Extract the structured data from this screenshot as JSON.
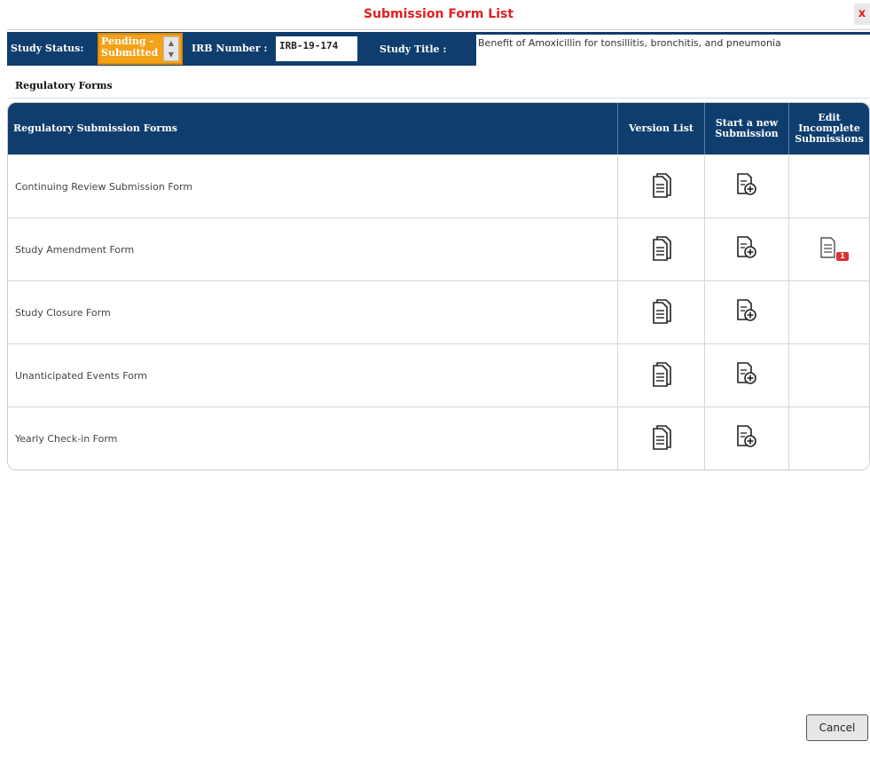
{
  "dialog": {
    "title": "Submission Form List",
    "close_label": "x"
  },
  "study": {
    "status_label": "Study Status:",
    "status_value": "Pending - Submitted",
    "irb_label": "IRB Number :",
    "irb_value": "IRB-19-174",
    "title_label": "Study Title :",
    "title_value": "Benefit of Amoxicillin for tonsillitis, bronchitis, and pneumonia"
  },
  "section": {
    "heading": "Regulatory Forms"
  },
  "table": {
    "headers": {
      "name": "Regulatory Submission Forms",
      "version": "Version List",
      "new_submission": "Start a new Submission",
      "edit_incomplete": "Edit Incomplete Submissions"
    },
    "rows": [
      {
        "name": "Continuing Review Submission Form",
        "incomplete_count": null
      },
      {
        "name": "Study Amendment Form",
        "incomplete_count": "1"
      },
      {
        "name": "Study Closure Form",
        "incomplete_count": null
      },
      {
        "name": "Unanticipated Events Form",
        "incomplete_count": null
      },
      {
        "name": "Yearly Check-in Form",
        "incomplete_count": null
      }
    ]
  },
  "footer": {
    "cancel_label": "Cancel"
  },
  "colors": {
    "header_bg": "#0f3d6e",
    "title_red": "#e02020",
    "status_orange": "#f4a11a",
    "badge_red": "#d9322f"
  },
  "icons": {
    "version": "document-stack-icon",
    "new_submission": "document-add-icon",
    "edit_incomplete": "document-edit-icon"
  }
}
